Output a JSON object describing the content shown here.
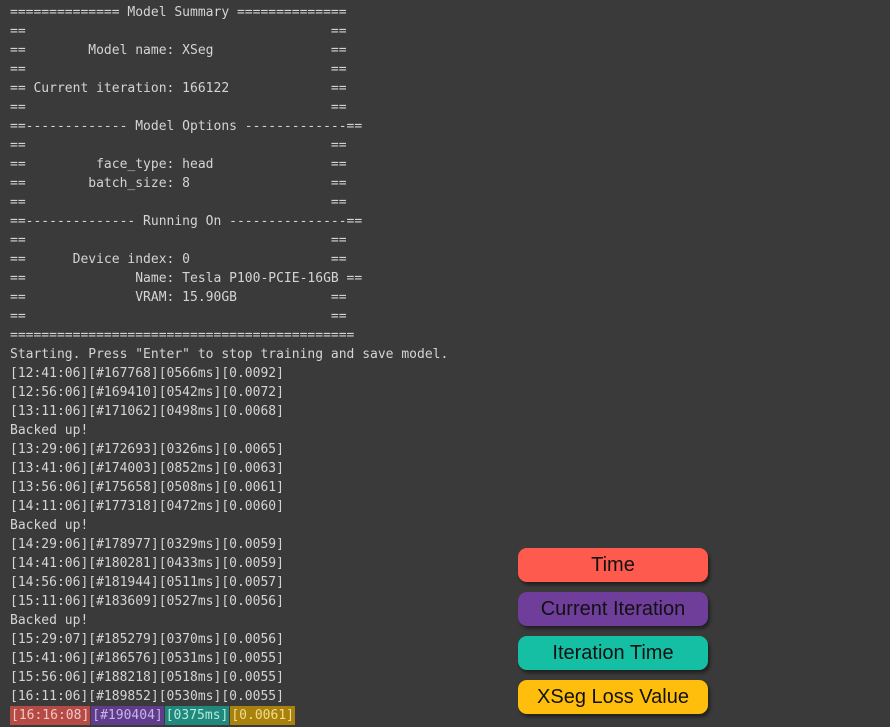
{
  "terminal": {
    "lines": [
      "============== Model Summary ==============",
      "==                                       ==",
      "==        Model name: XSeg               ==",
      "==                                       ==",
      "== Current iteration: 166122             ==",
      "==                                       ==",
      "==------------- Model Options -------------==",
      "==                                       ==",
      "==         face_type: head               ==",
      "==        batch_size: 8                  ==",
      "==                                       ==",
      "==-------------- Running On ---------------==",
      "==                                       ==",
      "==      Device index: 0                  ==",
      "==              Name: Tesla P100-PCIE-16GB ==",
      "==              VRAM: 15.90GB            ==",
      "==                                       ==",
      "============================================",
      "Starting. Press \"Enter\" to stop training and save model.",
      "[12:41:06][#167768][0566ms][0.0092]",
      "[12:56:06][#169410][0542ms][0.0072]",
      "[13:11:06][#171062][0498ms][0.0068]",
      "Backed up!",
      "[13:29:06][#172693][0326ms][0.0065]",
      "[13:41:06][#174003][0852ms][0.0063]",
      "[13:56:06][#175658][0508ms][0.0061]",
      "[14:11:06][#177318][0472ms][0.0060]",
      "Backed up!",
      "[14:29:06][#178977][0329ms][0.0059]",
      "[14:41:06][#180281][0433ms][0.0059]",
      "[14:56:06][#181944][0511ms][0.0057]",
      "[15:11:06][#183609][0527ms][0.0056]",
      "Backed up!",
      "[15:29:07][#185279][0370ms][0.0056]",
      "[15:41:06][#186576][0531ms][0.0055]",
      "[15:56:06][#188218][0518ms][0.0055]",
      "[16:11:06][#189852][0530ms][0.0055]"
    ],
    "last_line": {
      "time": "[16:16:08]",
      "iteration": "[#190404]",
      "iteration_time": "[0375ms]",
      "loss": "[0.0061]"
    }
  },
  "legend": [
    {
      "label": "Time",
      "color": "#ff5a4e"
    },
    {
      "label": "Current Iteration",
      "color": "#6f3d9a"
    },
    {
      "label": "Iteration Time",
      "color": "#14bfa3"
    },
    {
      "label": "XSeg Loss Value",
      "color": "#ffbe0b"
    }
  ]
}
